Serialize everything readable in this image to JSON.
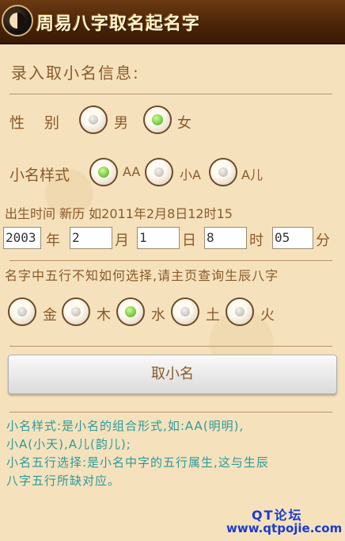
{
  "header": {
    "title": "周易八字取名起名字",
    "logo_icon": "yin-yang-icon"
  },
  "form": {
    "section_title": "录入取小名信息:",
    "gender": {
      "label": "性　 别",
      "options": [
        {
          "text": "男",
          "checked": false
        },
        {
          "text": "女",
          "checked": true
        }
      ]
    },
    "style": {
      "label": "小名样式",
      "options": [
        {
          "text": "AA",
          "checked": true
        },
        {
          "text": "小A",
          "checked": false
        },
        {
          "text": "A儿",
          "checked": false
        }
      ]
    },
    "birth": {
      "label": "出生时间 新历 如2011年2月8日12时15",
      "year": "2003",
      "year_unit": "年",
      "month": "2",
      "month_unit": "月",
      "day": "1",
      "day_unit": "日",
      "hour": "8",
      "hour_unit": "时",
      "minute": "05",
      "minute_unit": "分"
    },
    "element_hint": "名字中五行不知如何选择,请主页查询生辰八字",
    "elements": [
      {
        "text": "金",
        "checked": false
      },
      {
        "text": "木",
        "checked": false
      },
      {
        "text": "水",
        "checked": true
      },
      {
        "text": "土",
        "checked": false
      },
      {
        "text": "火",
        "checked": false
      }
    ],
    "submit_label": "取小名"
  },
  "info": {
    "line1": "小名样式:是小名的组合形式,如:AA(明明),",
    "line2": "小A(小天),A儿(韵儿);",
    "line3": "小名五行选择:是小名中字的五行属生,这与生辰",
    "line4": "八字五行所缺对应。"
  },
  "footer": {
    "forum": "QT论坛",
    "site": "www.qtpojie.com"
  },
  "colors": {
    "accent_check": "#4aa61a",
    "text": "#8a5a2a",
    "info_text": "#2e9a9a",
    "link": "#1a3ad0"
  }
}
